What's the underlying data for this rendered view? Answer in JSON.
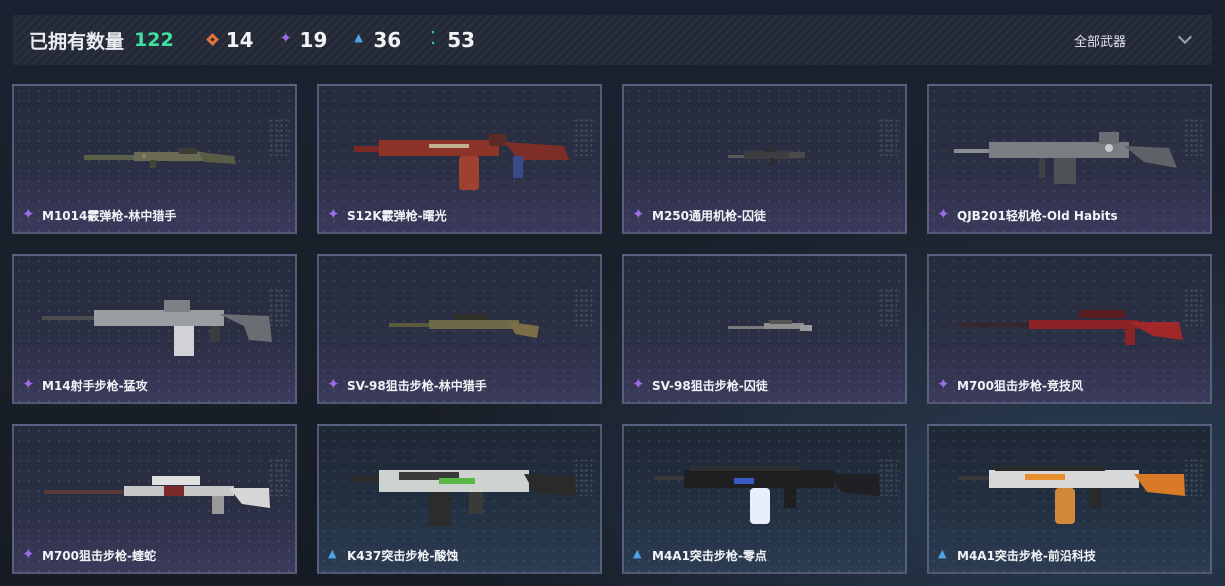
{
  "header": {
    "owned_label": "已拥有数量",
    "owned_count": "122",
    "rarities": [
      {
        "icon": "orange-rarity-icon",
        "color": "#e0743a",
        "count": "14"
      },
      {
        "icon": "purple-rarity-icon",
        "color": "#9b6ce6",
        "count": "19"
      },
      {
        "icon": "blue-rarity-icon",
        "color": "#4fa3e8",
        "count": "36"
      },
      {
        "icon": "green-rarity-icon",
        "color": "#39d7a0",
        "count": "53"
      }
    ],
    "filter_label": "全部武器"
  },
  "weapons": [
    {
      "name": "M1014霰弹枪-林中猎手",
      "rarity": "purple"
    },
    {
      "name": "S12K霰弹枪-曙光",
      "rarity": "purple"
    },
    {
      "name": "M250通用机枪-囚徒",
      "rarity": "purple"
    },
    {
      "name": "QJB201轻机枪-Old Habits",
      "rarity": "purple"
    },
    {
      "name": "M14射手步枪-猛攻",
      "rarity": "purple"
    },
    {
      "name": "SV-98狙击步枪-林中猎手",
      "rarity": "purple"
    },
    {
      "name": "SV-98狙击步枪-囚徒",
      "rarity": "purple"
    },
    {
      "name": "M700狙击步枪-竞技风",
      "rarity": "purple"
    },
    {
      "name": "M700狙击步枪-蝰蛇",
      "rarity": "purple"
    },
    {
      "name": "K437突击步枪-酸蚀",
      "rarity": "blue"
    },
    {
      "name": "M4A1突击步枪-零点",
      "rarity": "blue"
    },
    {
      "name": "M4A1突击步枪-前沿科技",
      "rarity": "blue"
    }
  ]
}
